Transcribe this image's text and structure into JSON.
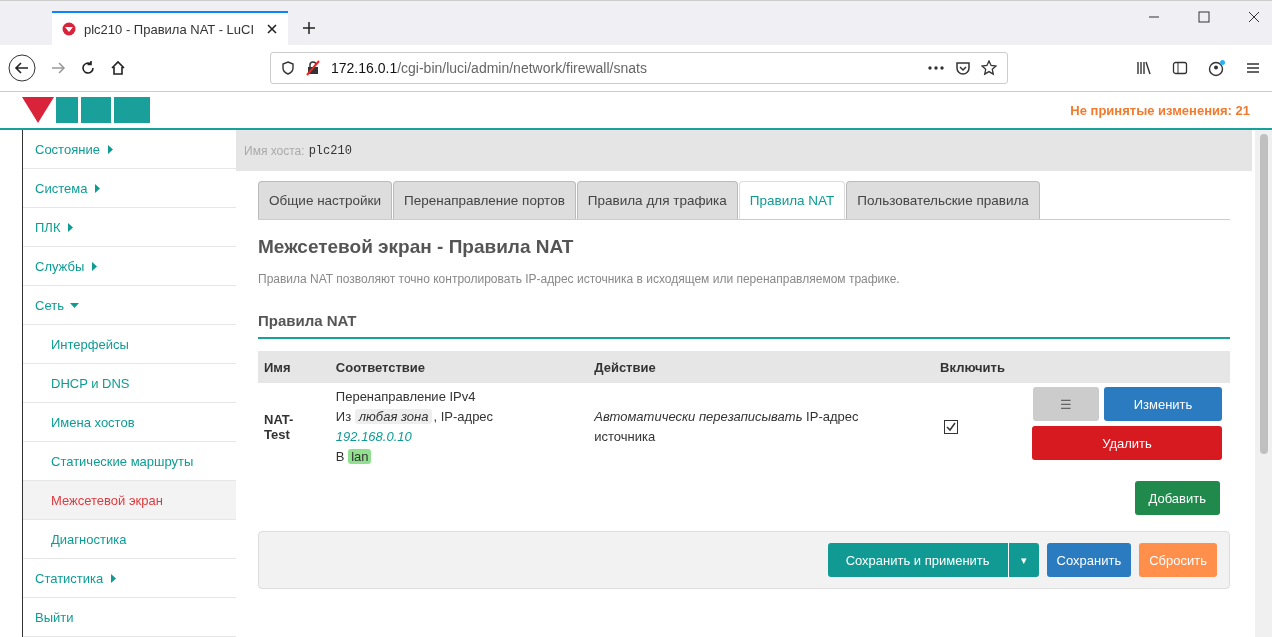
{
  "browser": {
    "tab_title": "plc210 - Правила NAT - LuCI",
    "url_host": "172.16.0.1",
    "url_path": "/cgi-bin/luci/admin/network/firewall/snats"
  },
  "header": {
    "changes": "Не принятые изменения: 21"
  },
  "sidebar": {
    "items": [
      {
        "label": "Состояние",
        "expanded": false
      },
      {
        "label": "Система",
        "expanded": false
      },
      {
        "label": "ПЛК",
        "expanded": false
      },
      {
        "label": "Службы",
        "expanded": false
      },
      {
        "label": "Сеть",
        "expanded": true,
        "children": [
          {
            "label": "Интерфейсы",
            "selected": false
          },
          {
            "label": "DHCP и DNS",
            "selected": false
          },
          {
            "label": "Имена хостов",
            "selected": false
          },
          {
            "label": "Статические маршруты",
            "selected": false
          },
          {
            "label": "Межсетевой экран",
            "selected": true
          },
          {
            "label": "Диагностика",
            "selected": false
          }
        ]
      },
      {
        "label": "Статистика",
        "expanded": false
      },
      {
        "label": "Выйти",
        "kind": "plain"
      }
    ]
  },
  "hostname": {
    "label": "Имя хоста:",
    "value": "plc210"
  },
  "tabs": [
    {
      "label": "Общие настройки",
      "selected": false
    },
    {
      "label": "Перенаправление портов",
      "selected": false
    },
    {
      "label": "Правила для трафика",
      "selected": false
    },
    {
      "label": "Правила NAT",
      "selected": true
    },
    {
      "label": "Пользовательские правила",
      "selected": false
    }
  ],
  "page_title": "Межсетевой экран - Правила NAT",
  "description": "Правила NAT позволяют точно контролировать IP-адрес источника в исходящем или перенаправляемом трафике.",
  "section_title": "Правила NAT",
  "table": {
    "columns": [
      "Имя",
      "Соответствие",
      "Действие",
      "Включить"
    ],
    "rows": [
      {
        "name": "NAT-Test",
        "match_family": "Перенаправление IPv4",
        "match_from": "Из",
        "match_zone": "любая зона",
        "match_addr_label": ", IP-адрес",
        "match_addr": "192.168.0.10",
        "match_to": "В",
        "match_dest_zone": "lan",
        "action": "*Автоматически перезаписывать* IP-адрес источника",
        "enabled": true,
        "buttons": {
          "menu": "☰",
          "edit": "Изменить",
          "delete": "Удалить"
        }
      }
    ]
  },
  "add_button": "Добавить",
  "footer": {
    "save_apply": "Сохранить и применить",
    "dropdown": "▾",
    "save": "Сохранить",
    "reset": "Сбросить"
  }
}
